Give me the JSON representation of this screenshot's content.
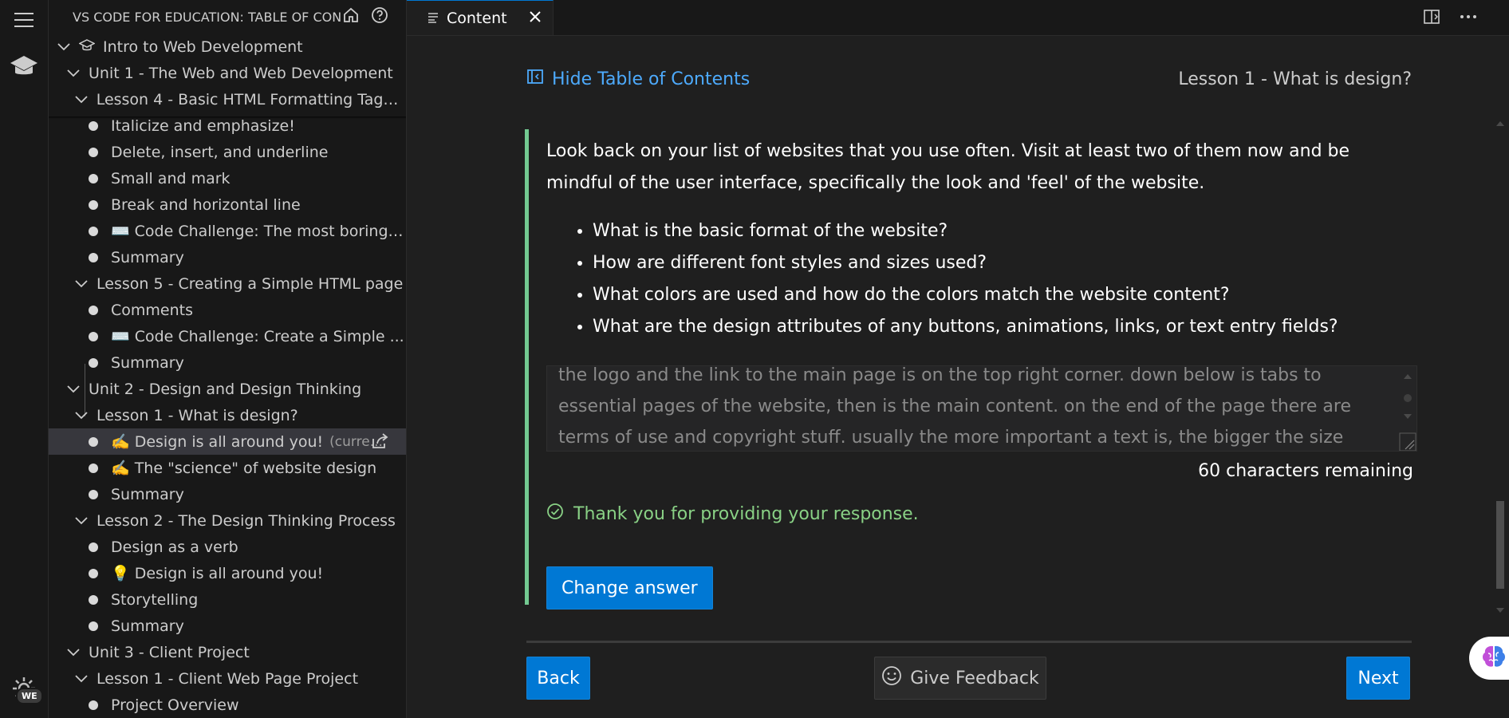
{
  "sidebar": {
    "title": "VS CODE FOR EDUCATION: TABLE OF CON...",
    "tree": [
      {
        "label": "Intro to Web Development",
        "icon": "mortarboard-icon"
      },
      {
        "label": "Unit 1 - The Web and Web Development"
      },
      {
        "label": "Lesson 4 - Basic HTML Formatting Tags ..."
      },
      {
        "label": "Italicize and emphasize!"
      },
      {
        "label": "Delete, insert, and underline"
      },
      {
        "label": "Small and mark"
      },
      {
        "label": "Break and horizontal line"
      },
      {
        "label": "⌨️ Code Challenge: The most boring ..."
      },
      {
        "label": "Summary"
      },
      {
        "label": "Lesson 5 - Creating a Simple HTML page"
      },
      {
        "label": "Comments"
      },
      {
        "label": "⌨️ Code Challenge: Create a Simple ..."
      },
      {
        "label": "Summary"
      },
      {
        "label": "Unit 2 - Design and Design Thinking"
      },
      {
        "label": "Lesson 1 - What is design?"
      },
      {
        "label": "✍️ Design is all around you!",
        "tag": "(curre..."
      },
      {
        "label": "✍️ The \"science\" of website design"
      },
      {
        "label": "Summary"
      },
      {
        "label": "Lesson 2 - The Design Thinking Process"
      },
      {
        "label": "Design as a verb"
      },
      {
        "label": "💡 Design is all around you!"
      },
      {
        "label": "Storytelling"
      },
      {
        "label": "Summary"
      },
      {
        "label": "Unit 3 - Client Project"
      },
      {
        "label": "Lesson 1 - Client Web Page Project"
      },
      {
        "label": "Project Overview"
      }
    ]
  },
  "activity": {
    "badge": "WE"
  },
  "tab": {
    "label": "Content"
  },
  "content": {
    "toc_link": "Hide Table of Contents",
    "lesson_title": "Lesson 1 - What is design?",
    "prompt": "Look back on your list of websites that you use often. Visit at least two of them now and be mindful of the user interface, specifically the look and 'feel' of the website.",
    "bullets": [
      "What is the basic format of the website?",
      "How are different font styles and sizes used?",
      "What colors are used and how do the colors match the website content?",
      "What are the design attributes of any buttons, animations, links, or text entry fields?"
    ],
    "answer_text": "the logo and the link to the main page is on the top right corner. down below is tabs to essential pages of the website, then is the main content. on the end of the page there are terms of use and copyright stuff. usually the more important a text is, the bigger the size and the more markedness the text is. and",
    "remaining": "60 characters remaining",
    "thanks": "Thank you for providing your response.",
    "change_button": "Change answer",
    "back_button": "Back",
    "feedback_button": "Give Feedback",
    "next_button": "Next"
  },
  "colors": {
    "accent": "#0078d4",
    "link": "#4daafc",
    "success": "#89d185",
    "card_border": "#73c991"
  }
}
